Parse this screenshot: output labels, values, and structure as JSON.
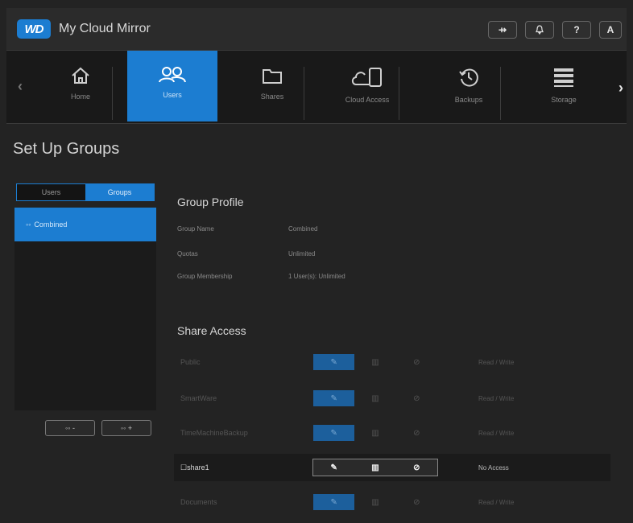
{
  "app": {
    "logo_text": "WD",
    "title": "My Cloud Mirror"
  },
  "header_icons": [
    {
      "name": "usb-icon",
      "glyph": "⇸"
    },
    {
      "name": "bell-icon",
      "glyph": "♫"
    },
    {
      "name": "help-icon",
      "glyph": "?"
    },
    {
      "name": "user-icon",
      "glyph": "A"
    }
  ],
  "nav": {
    "items": [
      {
        "id": "home",
        "label": "Home",
        "icon": "home-icon"
      },
      {
        "id": "users",
        "label": "Users",
        "icon": "users-icon",
        "active": true
      },
      {
        "id": "shares",
        "label": "Shares",
        "icon": "folder-icon"
      },
      {
        "id": "cloud-access",
        "label": "Cloud Access",
        "icon": "cloud-device-icon"
      },
      {
        "id": "backups",
        "label": "Backups",
        "icon": "history-icon"
      },
      {
        "id": "storage",
        "label": "Storage",
        "icon": "storage-icon"
      }
    ]
  },
  "page": {
    "title": "Set Up Groups"
  },
  "left_panel": {
    "toggle": {
      "users": "Users",
      "groups": "Groups"
    },
    "groups": [
      {
        "label": "Combined"
      }
    ],
    "buttons": {
      "remove": "-",
      "add": "+"
    }
  },
  "profile": {
    "title": "Group Profile",
    "fields": [
      {
        "label": "Group Name",
        "value": "Combined"
      },
      {
        "label": "Quotas",
        "value": "Unlimited"
      },
      {
        "label": "Group Membership",
        "value": "1 User(s): Unlimited"
      }
    ]
  },
  "share_access": {
    "title": "Share Access",
    "rows": [
      {
        "name": "Public",
        "status": "Read / Write",
        "dim": true,
        "selected": 0
      },
      {
        "name": "SmartWare",
        "status": "Read / Write",
        "dim": true,
        "selected": 0
      },
      {
        "name": "TimeMachineBackup",
        "status": "Read / Write",
        "dim": true,
        "selected": 0
      },
      {
        "name": "share1",
        "status": "No Access",
        "dim": false,
        "selected": 2
      },
      {
        "name": "Documents",
        "status": "Read / Write",
        "dim": true,
        "selected": 0
      }
    ],
    "option_glyphs": [
      "✎",
      "▥",
      "⊘"
    ]
  }
}
